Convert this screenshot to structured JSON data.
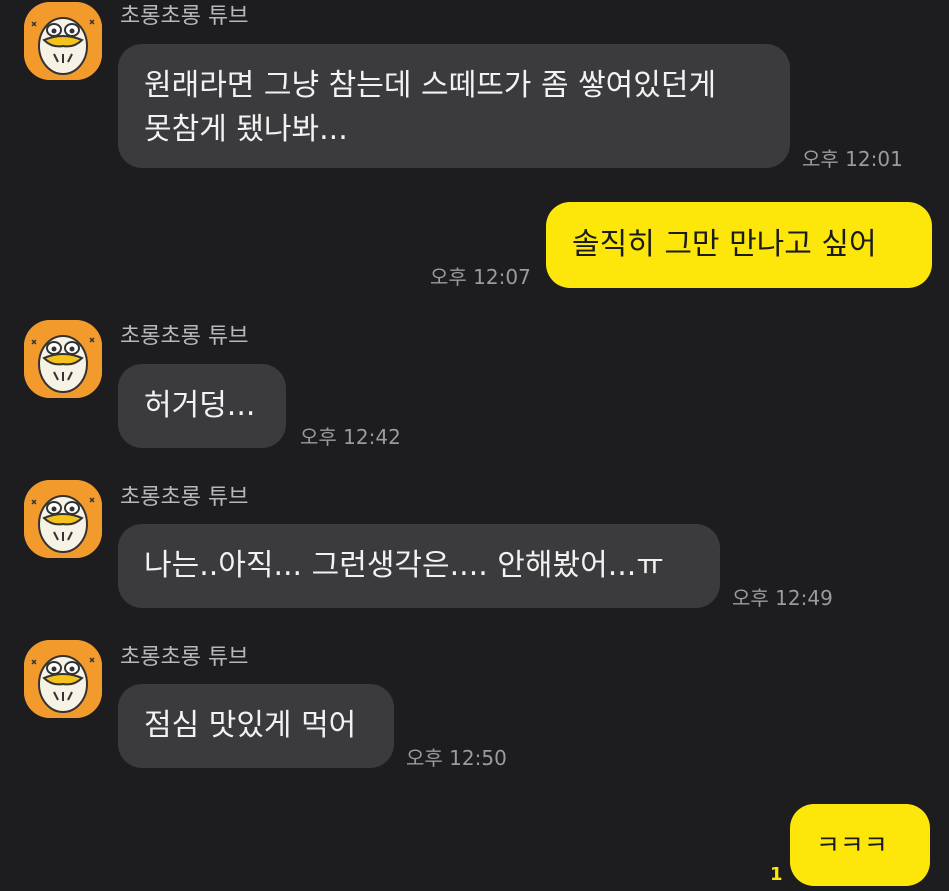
{
  "chat": {
    "colors": {
      "background": "#1d1d20",
      "incoming_bubble": "#3b3b3e",
      "outgoing_bubble": "#fde70a",
      "avatar": "#f39a2c"
    },
    "messages": [
      {
        "sender": "초롱초롱 튜브",
        "line1": "원래라면 그냥 참는데 스떼뜨가 좀 쌓여있던게",
        "line2": "못참게 됐나봐...",
        "time": "오후 12:01"
      },
      {
        "sender": "me",
        "text": "솔직히 그만 만나고 싶어",
        "time": "오후 12:07"
      },
      {
        "sender": "초롱초롱 튜브",
        "text": "허거덩...",
        "time": "오후 12:42"
      },
      {
        "sender": "초롱초롱 튜브",
        "text": "나는..아직... 그런생각은.... 안해봤어...ㅠ",
        "time": "오후 12:49"
      },
      {
        "sender": "초롱초롱 튜브",
        "text": "점심 맛있게 먹어",
        "time": "오후 12:50"
      },
      {
        "sender": "me",
        "text": "ㅋㅋㅋ",
        "unread": "1"
      }
    ],
    "avatar_icon": "tube-character-icon"
  }
}
